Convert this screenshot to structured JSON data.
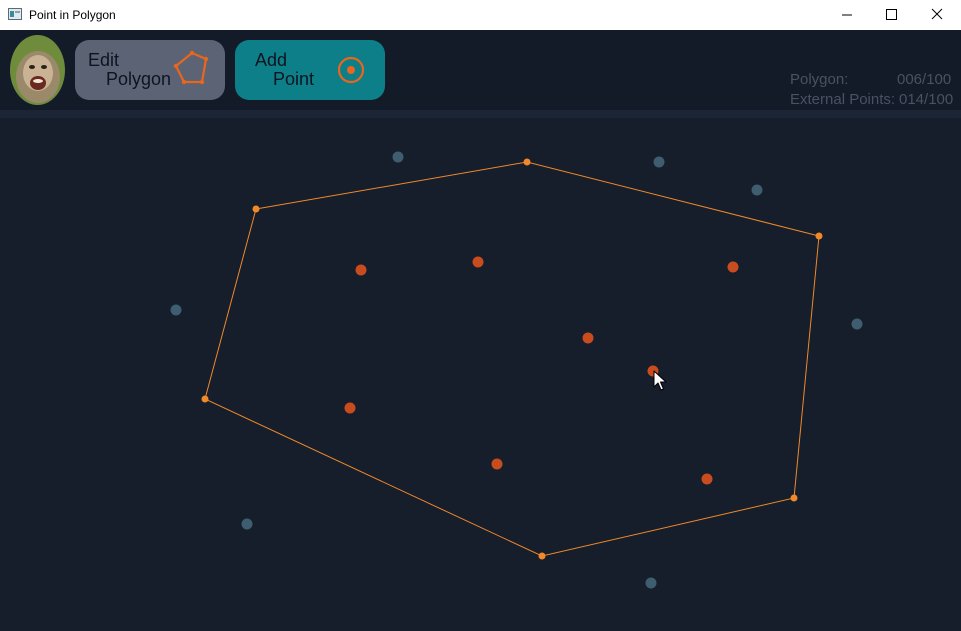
{
  "window": {
    "title": "Point in Polygon"
  },
  "toolbar": {
    "edit_button": {
      "line1": "Edit",
      "line2": "Polygon"
    },
    "add_button": {
      "line1": "Add",
      "line2": "Point"
    }
  },
  "stats": {
    "polygon_label": "Polygon:",
    "polygon_value": "006/100",
    "external_label": "External Points:",
    "external_value": "014/100"
  },
  "colors": {
    "background": "#161d2b",
    "polygon": "#f0892a",
    "inside_point": "#c94c1f",
    "outside_point": "#3e5e70",
    "edit_button": "#5b6375",
    "add_button": "#0d7f88"
  }
}
